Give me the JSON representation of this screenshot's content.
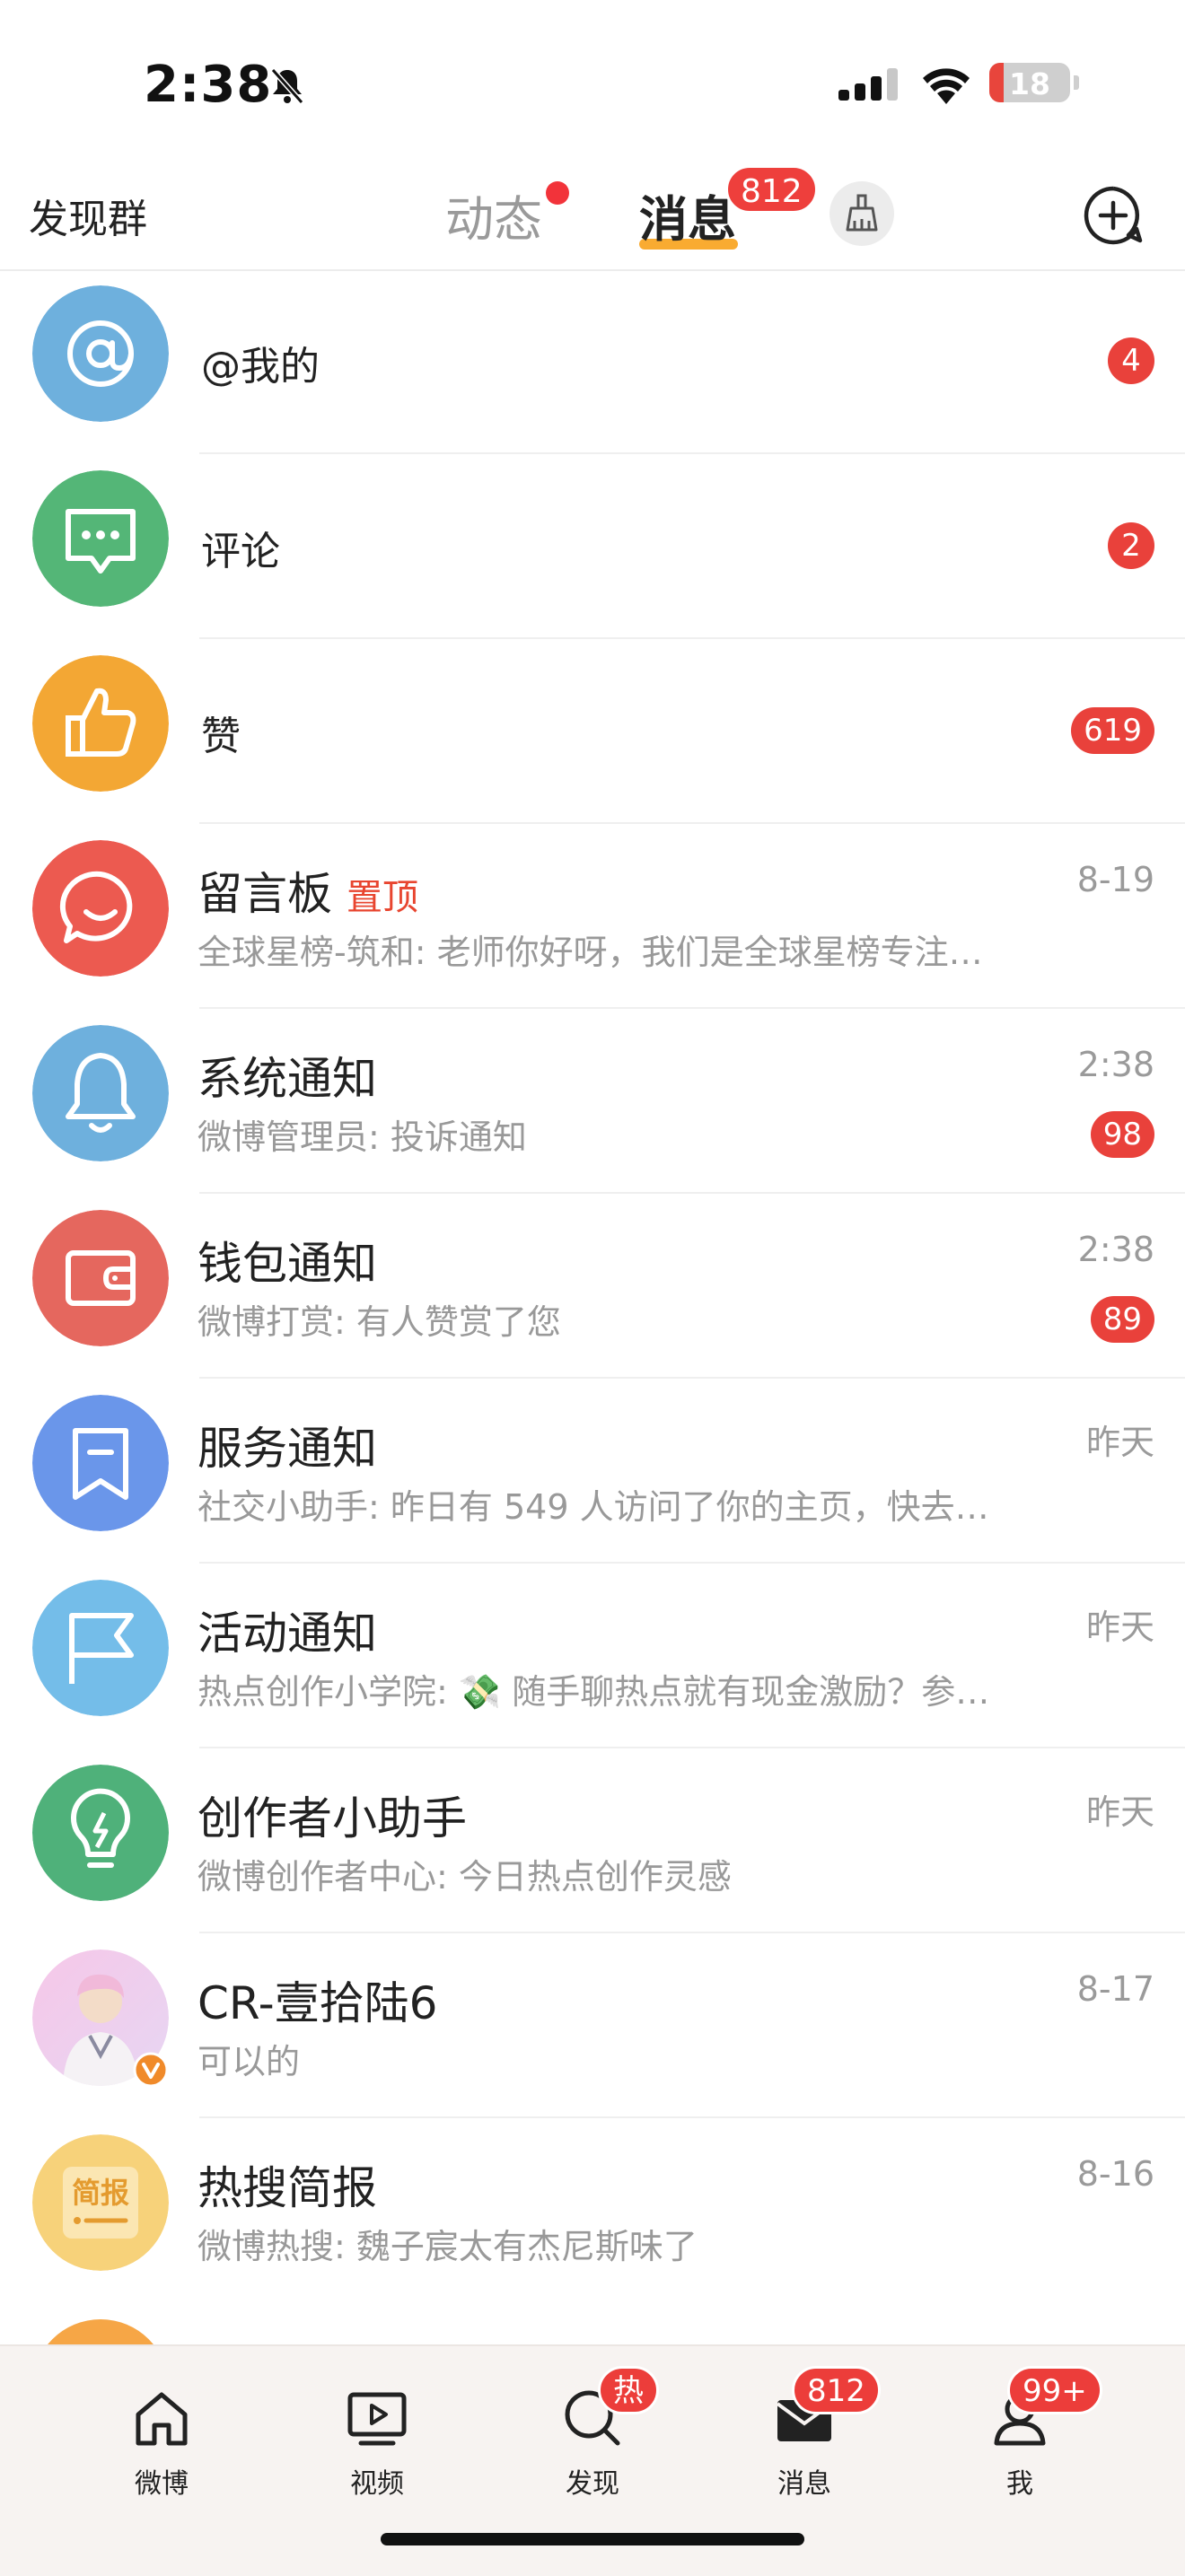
{
  "status_bar": {
    "time": "2:38",
    "battery": "18",
    "battery_level": 0.18
  },
  "header": {
    "left_link": "发现群",
    "tab_dynamic": "动态",
    "tab_messages": "消息",
    "messages_badge": "812"
  },
  "rows": [
    {
      "label": "@我的",
      "count": "4"
    },
    {
      "label": "评论",
      "count": "2"
    },
    {
      "label": "赞",
      "count": "619"
    },
    {
      "title": "留言板",
      "tag": "置顶",
      "preview": "全球星榜-筑和: 老师你好呀，我们是全球星榜专注…",
      "time": "8-19"
    },
    {
      "title": "系统通知",
      "preview": "微博管理员: 投诉通知",
      "time": "2:38",
      "count": "98"
    },
    {
      "title": "钱包通知",
      "preview": "微博打赏: 有人赞赏了您",
      "time": "2:38",
      "count": "89"
    },
    {
      "title": "服务通知",
      "preview": "社交小助手: 昨日有 549 人访问了你的主页，快去…",
      "time": "昨天"
    },
    {
      "title": "活动通知",
      "preview": "热点创作小学院: 💸 随手聊热点就有现金激励？参…",
      "time": "昨天"
    },
    {
      "title": "创作者小助手",
      "preview": "微博创作者中心: 今日热点创作灵感",
      "time": "昨天"
    },
    {
      "title": "CR-壹拾陆6",
      "preview": "可以的",
      "time": "8-17"
    },
    {
      "title": "热搜简报",
      "preview": "微博热搜: 魏子宸太有杰尼斯味了",
      "time": "8-16",
      "avatar_text": "简报"
    }
  ],
  "bottom_nav": [
    {
      "label": "微博"
    },
    {
      "label": "视频"
    },
    {
      "label": "发现",
      "badge": "热"
    },
    {
      "label": "消息",
      "badge": "812"
    },
    {
      "label": "我",
      "badge": "99+"
    }
  ],
  "colors": {
    "badge_red": "#e9413b",
    "tab_underline": "#f8a21b",
    "at_blue": "#6eb0dd",
    "comment_green": "#54b677",
    "like_orange": "#f3a734",
    "board_red": "#ec5a50",
    "notice_blue": "#6eb0dd",
    "wallet_red": "#e5675e",
    "service_blue": "#6a96ea",
    "activity_blue": "#74bde9",
    "creator_green": "#4fb17a"
  }
}
